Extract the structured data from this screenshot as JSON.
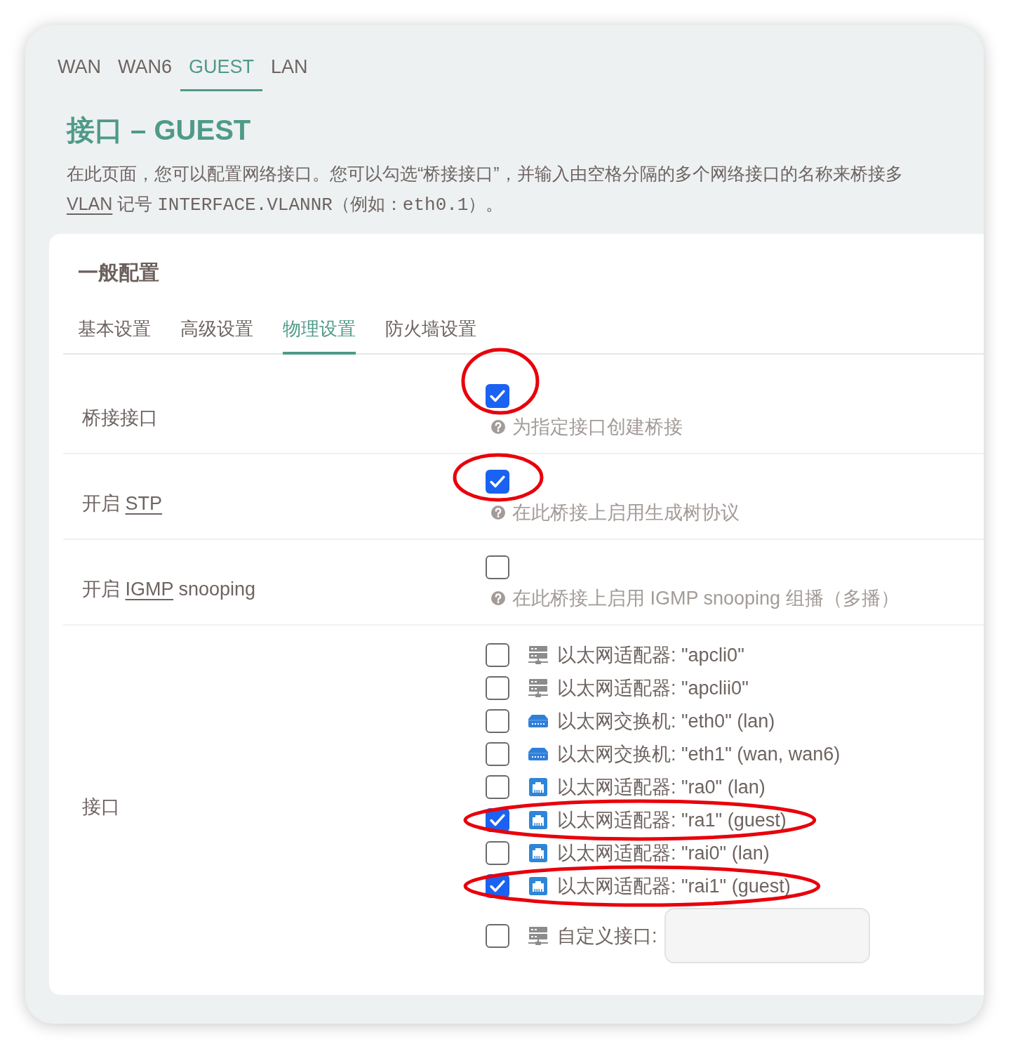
{
  "top_tabs": [
    {
      "label": "WAN",
      "selected": false
    },
    {
      "label": "WAN6",
      "selected": false
    },
    {
      "label": "GUEST",
      "selected": true
    },
    {
      "label": "LAN",
      "selected": false
    }
  ],
  "page_title": "接口 – GUEST",
  "description": [
    [
      {
        "kind": "text",
        "text": "在此页面，您可以配置网络接口。您可以勾选“桥接接口”，并输入由空格分隔的多个网络接口的名称来桥接多"
      }
    ],
    [
      {
        "kind": "abbr",
        "text": "VLAN"
      },
      {
        "kind": "text",
        "text": " 记号 "
      },
      {
        "kind": "code",
        "text": "INTERFACE.VLANNR"
      },
      {
        "kind": "text",
        "text": "（例如："
      },
      {
        "kind": "code",
        "text": "eth0.1"
      },
      {
        "kind": "text",
        "text": "）。"
      }
    ]
  ],
  "card": {
    "title": "一般配置",
    "tabs": [
      {
        "label": "基本设置",
        "selected": false
      },
      {
        "label": "高级设置",
        "selected": false
      },
      {
        "label": "物理设置",
        "selected": true
      },
      {
        "label": "防火墙设置",
        "selected": false
      }
    ],
    "options": [
      {
        "label": [
          {
            "kind": "text",
            "text": "桥接接口"
          }
        ],
        "checked": true,
        "circled": true,
        "hint": "为指定接口创建桥接"
      },
      {
        "label": [
          {
            "kind": "text",
            "text": "开启 "
          },
          {
            "kind": "abbr",
            "text": "STP"
          }
        ],
        "checked": true,
        "circled": true,
        "hint": "在此桥接上启用生成树协议"
      },
      {
        "label": [
          {
            "kind": "text",
            "text": "开启 "
          },
          {
            "kind": "abbr",
            "text": "IGMP"
          },
          {
            "kind": "text",
            "text": " snooping"
          }
        ],
        "checked": false,
        "circled": false,
        "hint": "在此桥接上启用 IGMP snooping 组播（多播）"
      }
    ],
    "interfaces": {
      "label": "接口",
      "items": [
        {
          "kind": "server",
          "text": "以太网适配器: \"apcli0\"",
          "checked": false,
          "circled": false
        },
        {
          "kind": "server",
          "text": "以太网适配器: \"apclii0\"",
          "checked": false,
          "circled": false
        },
        {
          "kind": "switch",
          "text": "以太网交换机: \"eth0\" (lan)",
          "checked": false,
          "circled": false
        },
        {
          "kind": "switch",
          "text": "以太网交换机: \"eth1\" (wan, wan6)",
          "checked": false,
          "circled": false
        },
        {
          "kind": "port",
          "text": "以太网适配器: \"ra0\" (lan)",
          "checked": false,
          "circled": false
        },
        {
          "kind": "port",
          "text": "以太网适配器: \"ra1\" (guest)",
          "checked": true,
          "circled": true
        },
        {
          "kind": "port",
          "text": "以太网适配器: \"rai0\" (lan)",
          "checked": false,
          "circled": false
        },
        {
          "kind": "port",
          "text": "以太网适配器: \"rai1\" (guest)",
          "checked": true,
          "circled": true
        }
      ],
      "custom": {
        "kind": "server",
        "label": "自定义接口:",
        "checked": false
      }
    }
  }
}
